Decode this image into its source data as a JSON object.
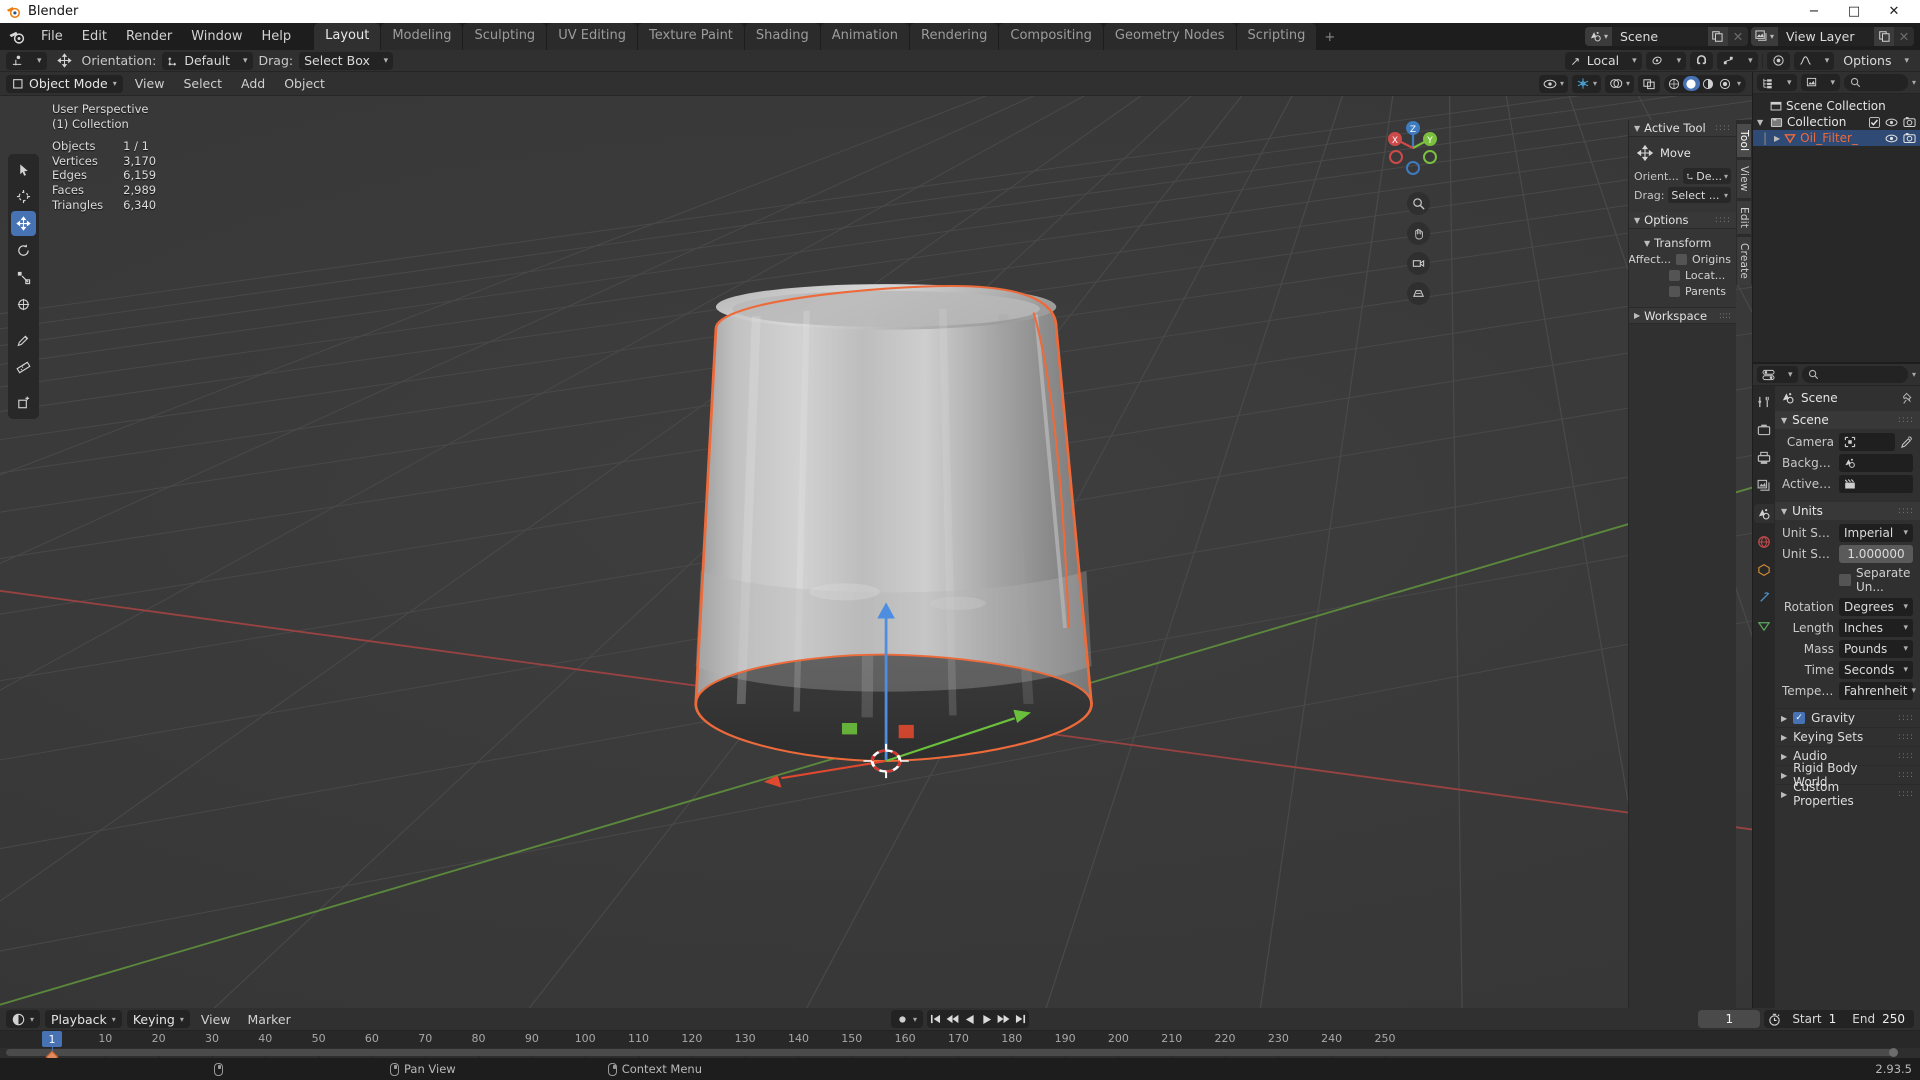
{
  "os_window": {
    "title": "Blender",
    "minimize": "−",
    "maximize": "□",
    "close": "✕"
  },
  "topbar": {
    "logo_icon": "blender-logo-icon",
    "menus": [
      "File",
      "Edit",
      "Render",
      "Window",
      "Help"
    ],
    "tabs": [
      {
        "label": "Layout",
        "active": true
      },
      {
        "label": "Modeling",
        "active": false
      },
      {
        "label": "Sculpting",
        "active": false
      },
      {
        "label": "UV Editing",
        "active": false
      },
      {
        "label": "Texture Paint",
        "active": false
      },
      {
        "label": "Shading",
        "active": false
      },
      {
        "label": "Animation",
        "active": false
      },
      {
        "label": "Rendering",
        "active": false
      },
      {
        "label": "Compositing",
        "active": false
      },
      {
        "label": "Geometry Nodes",
        "active": false
      },
      {
        "label": "Scripting",
        "active": false
      }
    ],
    "add_tab_label": "+",
    "scene_icon": "scene-icon",
    "scene_name": "Scene",
    "scene_new_icon": "duplicate-icon",
    "scene_unlink_icon": "x-icon",
    "view_layer_icon": "view-layer-icon",
    "view_layer_name": "View Layer",
    "view_layer_new_icon": "duplicate-icon",
    "view_layer_remove_icon": "x-icon"
  },
  "tool_settings": {
    "tool_icon": "cursor-tool-icon",
    "move_icon": "move-tool-icon",
    "orientation_label": "Orientation:",
    "orientation_value": "Default",
    "drag_label": "Drag:",
    "drag_value": "Select Box",
    "transform_space": "Local",
    "snap_icon": "magnet-icon",
    "proportional_icon": "proportional-edit-icon",
    "proportional_falloff_icon": "smooth-falloff-icon",
    "options_label": "Options"
  },
  "viewport": {
    "mode": "Object Mode",
    "menus": [
      "View",
      "Select",
      "Add",
      "Object"
    ],
    "overlay_icons": [
      "visibility-icon",
      "gizmo-icon",
      "overlays-icon",
      "xray-icon"
    ],
    "shading_modes": [
      "wireframe-icon",
      "solid-icon",
      "material-preview-icon",
      "rendered-icon"
    ],
    "active_shading": "solid-icon",
    "stats": {
      "perspective": "User Perspective",
      "collection": "(1) Collection",
      "rows": [
        {
          "key": "Objects",
          "value": "1 / 1"
        },
        {
          "key": "Vertices",
          "value": "3,170"
        },
        {
          "key": "Edges",
          "value": "6,159"
        },
        {
          "key": "Faces",
          "value": "2,989"
        },
        {
          "key": "Triangles",
          "value": "6,340"
        }
      ]
    },
    "toolbar": [
      {
        "name": "tweak-tool",
        "icon": "cursor-arrow-icon",
        "active": false
      },
      {
        "name": "cursor-tool",
        "icon": "3d-cursor-icon",
        "active": false
      },
      {
        "name": "move-tool",
        "icon": "move-icon",
        "active": true
      },
      {
        "name": "rotate-tool",
        "icon": "rotate-icon",
        "active": false
      },
      {
        "name": "scale-tool",
        "icon": "scale-icon",
        "active": false
      },
      {
        "name": "transform-tool",
        "icon": "transform-icon",
        "active": false
      },
      {
        "name": "annotate-tool",
        "icon": "pencil-icon",
        "active": false
      },
      {
        "name": "measure-tool",
        "icon": "ruler-icon",
        "active": false
      },
      {
        "name": "add-cube-tool",
        "icon": "add-cube-icon",
        "active": false
      }
    ],
    "gizmo_axes": {
      "x": "X",
      "y": "Y",
      "z": "Z"
    },
    "nav_buttons": [
      "zoom-icon",
      "hand-icon",
      "camera-icon",
      "ortho-persp-icon"
    ],
    "object_name": "Oil_Filter_"
  },
  "sidebar_n": {
    "vertical_tabs": [
      {
        "label": "Tool",
        "active": true
      },
      {
        "label": "View",
        "active": false
      },
      {
        "label": "Edit",
        "active": false
      },
      {
        "label": "Create",
        "active": false
      }
    ],
    "active_tool": {
      "panel_title": "Active Tool",
      "tool_icon": "move-tool-icon",
      "tool_name": "Move",
      "orientation_label": "Orient...",
      "orientation_value": "De...",
      "drag_label": "Drag:",
      "drag_value": "Select ..."
    },
    "options": {
      "panel_title": "Options",
      "transform_title": "Transform",
      "affect_label": "Affect...",
      "checkboxes": [
        {
          "label": "Origins",
          "checked": false
        },
        {
          "label": "Locat...",
          "checked": false
        },
        {
          "label": "Parents",
          "checked": false
        }
      ]
    },
    "workspace": {
      "panel_title": "Workspace"
    }
  },
  "outliner": {
    "display_mode_icon": "outliner-icon",
    "filter_icon": "filter-icon",
    "search_icon": "search-icon",
    "search_placeholder": "",
    "rows": [
      {
        "indent": 0,
        "icon": "scene-collection-icon",
        "label": "Scene Collection",
        "selected": false,
        "expander": "",
        "eye": false,
        "camera": false,
        "check": false
      },
      {
        "indent": 1,
        "icon": "collection-icon",
        "label": "Collection",
        "selected": false,
        "expander": "▼",
        "eye": true,
        "camera": true,
        "check": true
      },
      {
        "indent": 2,
        "icon": "mesh-data-icon",
        "label": "Oil_Filter_",
        "selected": true,
        "expander": "▶",
        "eye": true,
        "camera": true,
        "check": false
      }
    ]
  },
  "properties": {
    "editor_type_icon": "properties-icon",
    "search_icon": "search-icon",
    "search_placeholder": "",
    "tabs": [
      {
        "name": "tool-tab",
        "icon": "tool-icon",
        "active": false
      },
      {
        "name": "render-tab",
        "icon": "camera-back-icon",
        "active": false
      },
      {
        "name": "output-tab",
        "icon": "printer-icon",
        "active": false
      },
      {
        "name": "view-layer-tab",
        "icon": "images-icon",
        "active": false
      },
      {
        "name": "scene-tab",
        "icon": "scene-icon",
        "active": true
      },
      {
        "name": "world-tab",
        "icon": "world-icon",
        "active": false
      },
      {
        "name": "object-tab",
        "icon": "object-icon",
        "active": false
      },
      {
        "name": "modifier-tab",
        "icon": "wrench-icon",
        "active": false
      },
      {
        "name": "data-tab",
        "icon": "mesh-data-icon",
        "active": false
      }
    ],
    "breadcrumb_icon": "scene-icon",
    "breadcrumb": "Scene",
    "pin_icon": "pin-icon",
    "scene_panel": {
      "title": "Scene",
      "rows": [
        {
          "label": "Camera",
          "value": "",
          "icon": "camera-data-icon",
          "eyedropper": true
        },
        {
          "label": "Backgrou...",
          "value": "",
          "icon": "scene-icon",
          "eyedropper": false
        },
        {
          "label": "Active Clip",
          "value": "",
          "icon": "clip-icon",
          "eyedropper": false
        }
      ]
    },
    "units_panel": {
      "title": "Units",
      "unit_system_label": "Unit Syste...",
      "unit_system_value": "Imperial",
      "unit_scale_label": "Unit Scale",
      "unit_scale_value": "1.000000",
      "separate_units_label": "Separate Un...",
      "separate_units_checked": false,
      "rows": [
        {
          "label": "Rotation",
          "value": "Degrees"
        },
        {
          "label": "Length",
          "value": "Inches"
        },
        {
          "label": "Mass",
          "value": "Pounds"
        },
        {
          "label": "Time",
          "value": "Seconds"
        },
        {
          "label": "Temperat...",
          "value": "Fahrenheit"
        }
      ]
    },
    "closed_panels": [
      {
        "label": "Gravity",
        "checkbox": true,
        "checked": true
      },
      {
        "label": "Keying Sets",
        "checkbox": false,
        "checked": false
      },
      {
        "label": "Audio",
        "checkbox": false,
        "checked": false
      },
      {
        "label": "Rigid Body World",
        "checkbox": false,
        "checked": false
      },
      {
        "label": "Custom Properties",
        "checkbox": false,
        "checked": false
      }
    ]
  },
  "timeline": {
    "editor_icon": "timeline-icon",
    "menus": [
      {
        "label": "Playback",
        "dropdown": true
      },
      {
        "label": "Keying",
        "dropdown": true
      },
      {
        "label": "View",
        "dropdown": false
      },
      {
        "label": "Marker",
        "dropdown": false
      }
    ],
    "record_icon": "record-icon",
    "playback_buttons": [
      "jump-start-icon",
      "prev-keyframe-icon",
      "play-reverse-icon",
      "play-icon",
      "next-keyframe-icon",
      "jump-end-icon"
    ],
    "current_frame": "1",
    "timer_icon": "timer-icon",
    "start_label": "Start",
    "start_value": "1",
    "end_label": "End",
    "end_value": "250",
    "ticks": [
      "1",
      "10",
      "20",
      "30",
      "40",
      "50",
      "60",
      "70",
      "80",
      "90",
      "100",
      "110",
      "120",
      "130",
      "140",
      "150",
      "160",
      "170",
      "180",
      "190",
      "200",
      "210",
      "220",
      "230",
      "240",
      "250"
    ],
    "playhead_frame": "1",
    "keyframe_frame": 1
  },
  "status_bar": {
    "items": [
      {
        "icon": "mouse-left-icon",
        "label": ""
      },
      {
        "icon": "mouse-middle-icon",
        "label": "Pan View"
      },
      {
        "icon": "mouse-right-icon",
        "label": "Context Menu"
      }
    ],
    "version": "2.93.5"
  },
  "colors": {
    "accent": "#4772b3",
    "selection_outline": "#ed6a3b",
    "x_axis": "#cc4a4a",
    "y_axis": "#7bbf3f",
    "z_axis": "#3f7bbf",
    "bg_dark": "#1d1d1d",
    "bg_panel": "#303030",
    "bg_editor": "#282828"
  }
}
